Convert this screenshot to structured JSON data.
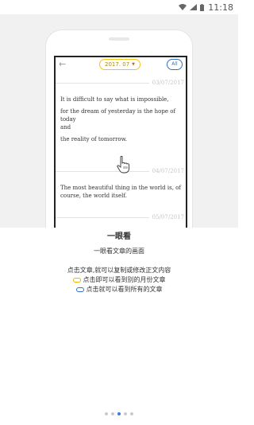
{
  "status_bar": {
    "time": "11:18",
    "icons": [
      "wifi-icon",
      "signal-icon",
      "battery-icon"
    ]
  },
  "mock_app": {
    "date_pill": "2017. 07",
    "all_pill": "All",
    "entries": [
      {
        "date": "03/07/2017",
        "lines": [
          "It is difficult to say what is impossible,",
          "for the dream of yesterday is the hope of today",
          "and",
          "the reality of tomorrow."
        ]
      },
      {
        "date": "04/07/2017",
        "lines": [
          "The most beautiful thing in the world is, of",
          "course, the world itself."
        ]
      },
      {
        "date": "05/07/2017",
        "lines": []
      }
    ]
  },
  "guide": {
    "title": "一眼看",
    "subtitle": "一眼看文章的画面",
    "line1": "点击文章,就可以复制或修改正文内容",
    "line2": "点击即可以看到别的月份文章",
    "line3": "点击就可以看到所有的文章"
  },
  "pager": {
    "count": 5,
    "active_index": 2
  },
  "colors": {
    "accent_yellow": "#f0c419",
    "accent_blue": "#2f72c6",
    "pager_active": "#3a7de0"
  }
}
